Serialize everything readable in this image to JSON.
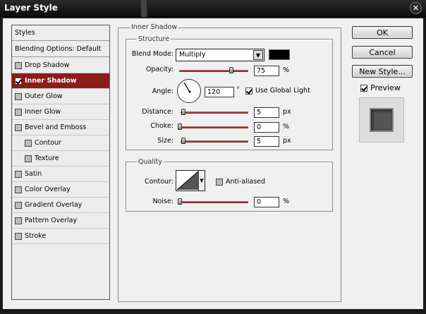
{
  "window": {
    "title": "Layer Style",
    "close_glyph": "✕"
  },
  "styles_list": {
    "header": "Styles",
    "blending": "Blending Options: Default",
    "items": [
      {
        "label": "Drop Shadow",
        "checked": false
      },
      {
        "label": "Inner Shadow",
        "checked": true,
        "selected": true
      },
      {
        "label": "Outer Glow",
        "checked": false
      },
      {
        "label": "Inner Glow",
        "checked": false
      },
      {
        "label": "Bevel and Emboss",
        "checked": false
      },
      {
        "label": "Contour",
        "checked": false,
        "sub": true
      },
      {
        "label": "Texture",
        "checked": false,
        "sub": true
      },
      {
        "label": "Satin",
        "checked": false
      },
      {
        "label": "Color Overlay",
        "checked": false
      },
      {
        "label": "Gradient Overlay",
        "checked": false
      },
      {
        "label": "Pattern Overlay",
        "checked": false
      },
      {
        "label": "Stroke",
        "checked": false
      }
    ]
  },
  "panel": {
    "title": "Inner Shadow",
    "structure": {
      "legend": "Structure",
      "blend_mode_label": "Blend Mode:",
      "blend_mode_value": "Multiply",
      "shadow_color": "#000000",
      "opacity_label": "Opacity:",
      "opacity_value": "75",
      "opacity_unit": "%",
      "opacity_fraction": 0.75,
      "angle_label": "Angle:",
      "angle_value": "120",
      "angle_unit": "°",
      "use_global_light_label": "Use Global Light",
      "use_global_light": true,
      "distance_label": "Distance:",
      "distance_value": "5",
      "distance_unit": "px",
      "choke_label": "Choke:",
      "choke_value": "0",
      "choke_unit": "%",
      "size_label": "Size:",
      "size_value": "5",
      "size_unit": "px"
    },
    "quality": {
      "legend": "Quality",
      "contour_label": "Contour:",
      "anti_aliased_label": "Anti-aliased",
      "anti_aliased": false,
      "noise_label": "Noise:",
      "noise_value": "0",
      "noise_unit": "%"
    }
  },
  "buttons": {
    "ok": "OK",
    "cancel": "Cancel",
    "new_style": "New Style...",
    "preview_label": "Preview",
    "preview_checked": true
  },
  "colors": {
    "selected_bg": "#8e1b1b",
    "slider": "#8e2a30"
  }
}
